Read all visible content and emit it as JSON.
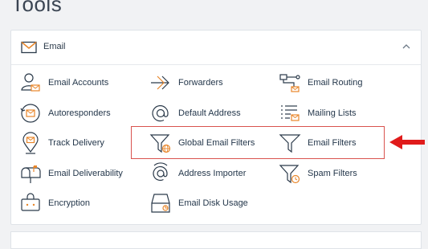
{
  "page": {
    "title": "Tools"
  },
  "section": {
    "title": "Email"
  },
  "colors": {
    "accent": "#e8862a",
    "icon": "#2b3a4a",
    "highlight_border": "#d9534f",
    "arrow": "#e01b1b"
  },
  "tools": [
    {
      "label": "Email Accounts",
      "icon": "user-email-icon"
    },
    {
      "label": "Forwarders",
      "icon": "forward-arrow-icon"
    },
    {
      "label": "Email Routing",
      "icon": "routing-icon"
    },
    {
      "label": "Autoresponders",
      "icon": "autoresponder-icon"
    },
    {
      "label": "Default Address",
      "icon": "at-sign-icon"
    },
    {
      "label": "Mailing Lists",
      "icon": "list-icon"
    },
    {
      "label": "Track Delivery",
      "icon": "map-pin-email-icon"
    },
    {
      "label": "Global Email Filters",
      "icon": "funnel-globe-icon"
    },
    {
      "label": "Email Filters",
      "icon": "funnel-icon"
    },
    {
      "label": "Email Deliverability",
      "icon": "mailbox-icon"
    },
    {
      "label": "Address Importer",
      "icon": "at-import-icon"
    },
    {
      "label": "Spam Filters",
      "icon": "funnel-clock-icon"
    },
    {
      "label": "Encryption",
      "icon": "encryption-key-icon"
    },
    {
      "label": "Email Disk Usage",
      "icon": "disk-usage-icon"
    }
  ]
}
